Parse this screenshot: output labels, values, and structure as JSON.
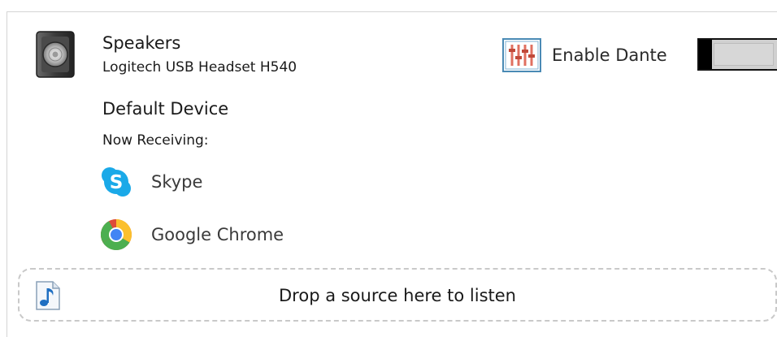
{
  "device": {
    "name": "Speakers",
    "model": "Logitech USB Headset H540",
    "icon": "speaker-icon"
  },
  "status": {
    "default_label": "Default Device",
    "receiving_label": "Now Receiving:"
  },
  "sources": [
    {
      "label": "Skype",
      "icon": "skype-icon",
      "color": "#1aa9e8"
    },
    {
      "label": "Google Chrome",
      "icon": "chrome-icon",
      "color": "#dd4b39"
    }
  ],
  "dante": {
    "label": "Enable Dante",
    "icon": "mixer-icon",
    "enabled": false
  },
  "drop_zone": {
    "text": "Drop a source here to listen",
    "icon": "music-file-icon"
  },
  "colors": {
    "accent": "#1aa9e8",
    "dante_icon": "#e07060",
    "border": "#d4d4d4"
  }
}
